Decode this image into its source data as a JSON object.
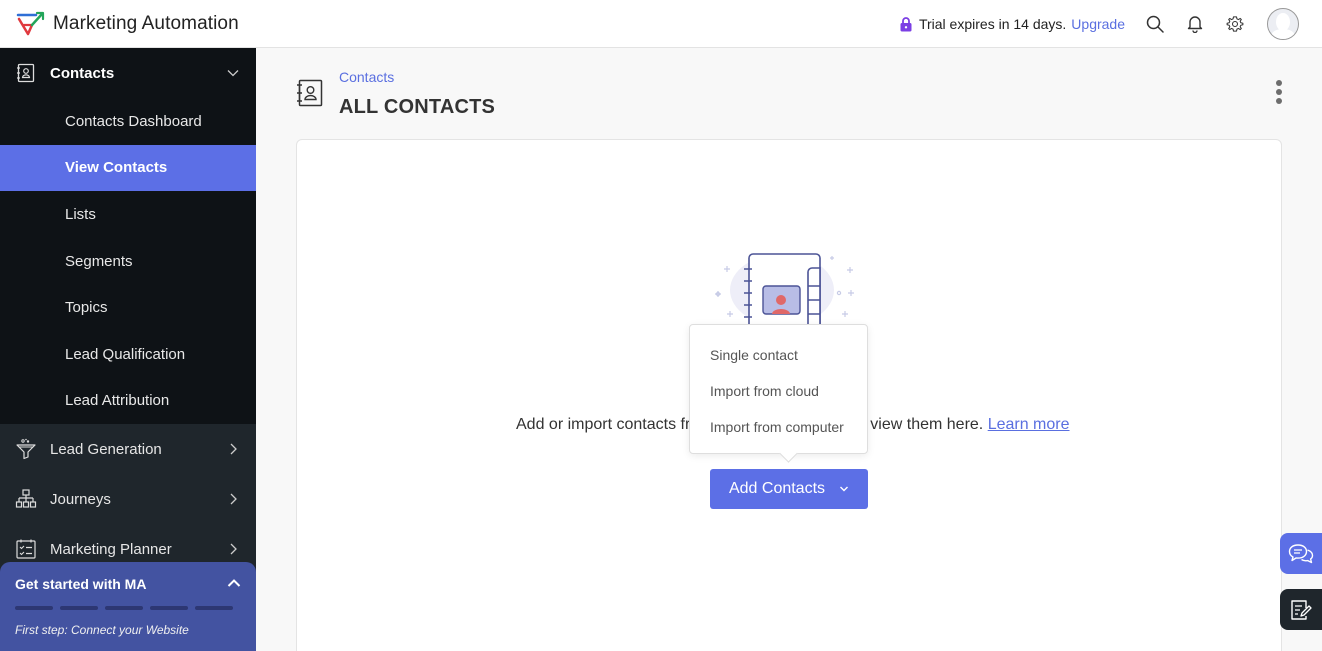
{
  "header": {
    "app_name": "Marketing Automation",
    "trial_text": "Trial expires in 14 days.",
    "upgrade_label": "Upgrade",
    "icons": [
      "search-icon",
      "bell-icon",
      "gear-icon",
      "avatar"
    ]
  },
  "sidebar": {
    "contacts": {
      "label": "Contacts",
      "icon": "contacts-book-icon",
      "expanded": true,
      "items": [
        {
          "label": "Contacts Dashboard",
          "active": false
        },
        {
          "label": "View Contacts",
          "active": true
        },
        {
          "label": "Lists",
          "active": false
        },
        {
          "label": "Segments",
          "active": false
        },
        {
          "label": "Topics",
          "active": false
        },
        {
          "label": "Lead Qualification",
          "active": false
        },
        {
          "label": "Lead Attribution",
          "active": false
        }
      ]
    },
    "sections": [
      {
        "label": "Lead Generation",
        "icon": "funnel-icon"
      },
      {
        "label": "Journeys",
        "icon": "hierarchy-icon"
      },
      {
        "label": "Marketing Planner",
        "icon": "checklist-icon"
      }
    ],
    "get_started": {
      "title": "Get started with MA",
      "step_text": "First step: Connect your Website",
      "steps_total": 5,
      "steps_completed": 0
    }
  },
  "page": {
    "breadcrumb": "Contacts",
    "title": "ALL CONTACTS",
    "empty_text_before": "Add or import contacts fr",
    "empty_text_after": "view them here.",
    "learn_more": "Learn more",
    "add_button_label": "Add Contacts",
    "dropdown": {
      "items": [
        "Single contact",
        "Import from cloud",
        "Import from computer"
      ]
    }
  },
  "colors": {
    "accent": "#5c6fe6",
    "sidebar_bg": "#1f262c",
    "sidebar_group_bg": "#0e1216",
    "get_started_bg": "#4353a1",
    "lock": "#7b3fe4"
  }
}
